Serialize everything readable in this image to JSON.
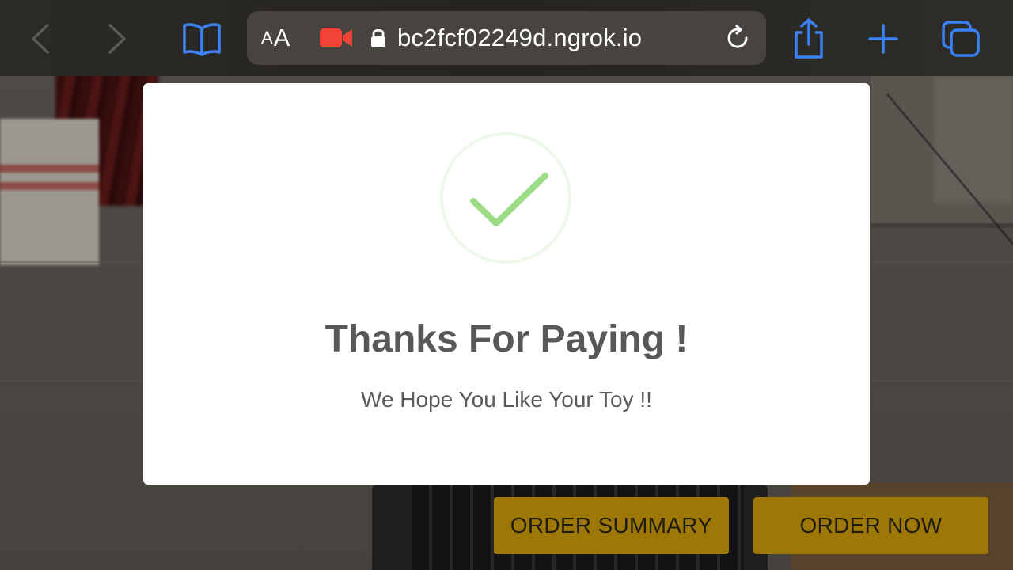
{
  "browser": {
    "url": "bc2fcf02249d.ngrok.io",
    "reader_small": "A",
    "reader_big": "A"
  },
  "modal": {
    "title": "Thanks For Paying !",
    "subtitle": "We Hope You Like Your Toy !!"
  },
  "buttons": {
    "order_summary": "ORDER SUMMARY",
    "order_now": "ORDER NOW"
  },
  "icons": {
    "back": "chevron-left-icon",
    "forward": "chevron-right-icon",
    "bookmarks": "book-icon",
    "camera": "video-camera-icon",
    "lock": "lock-icon",
    "reload": "reload-icon",
    "share": "share-icon",
    "new_tab": "plus-icon",
    "tabs": "tabs-icon",
    "success": "checkmark-icon"
  },
  "colors": {
    "toolbar_accent": "#3b82f6",
    "camera_red": "#f04438",
    "success_green": "#9ddc86",
    "button_gold": "#9e7806"
  }
}
